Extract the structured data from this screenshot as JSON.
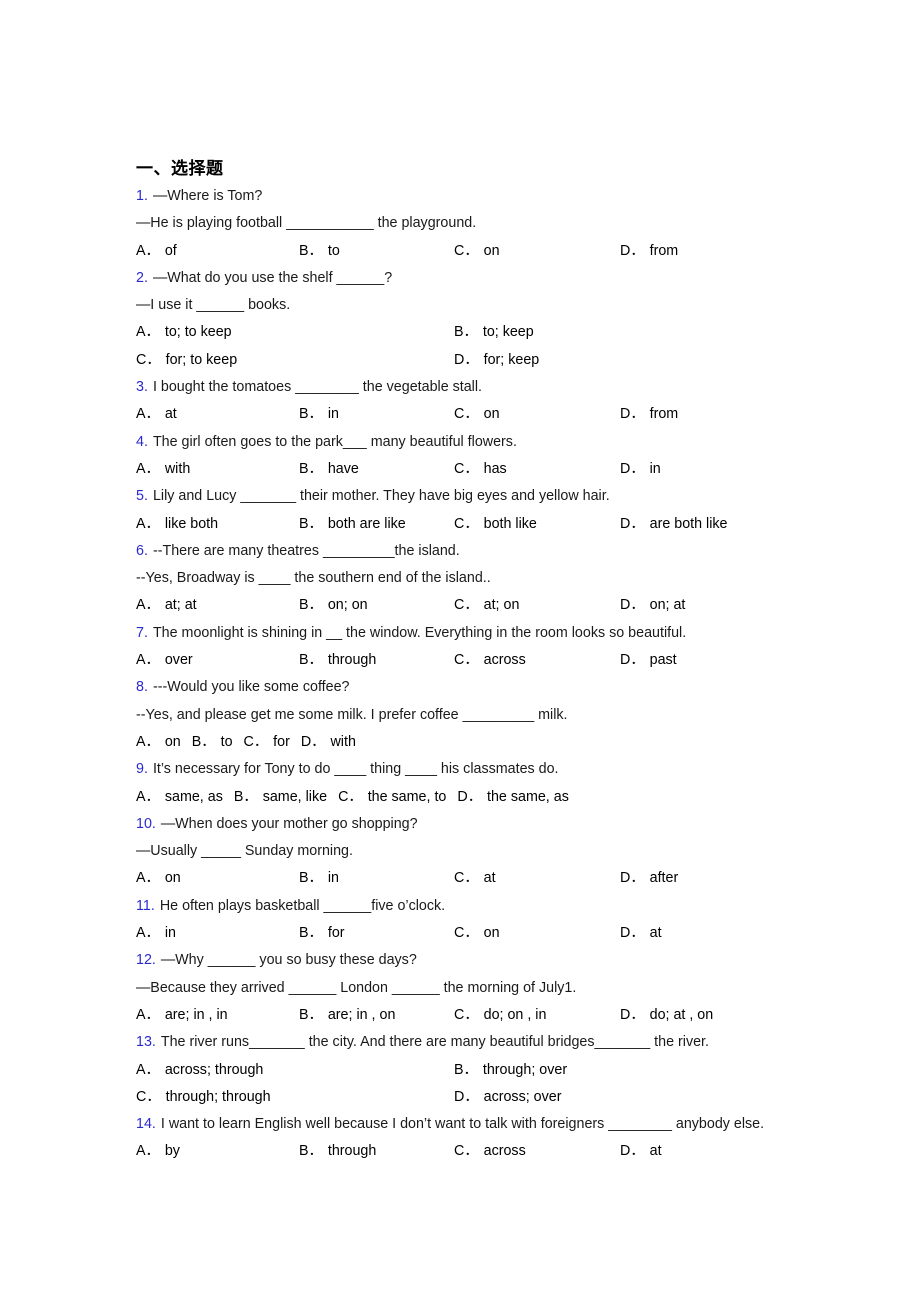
{
  "section": {
    "title": "一、选择题"
  },
  "accent_color": "#2a2ad0",
  "questions": [
    {
      "num": "1.",
      "lines": [
        "—Where is Tom?",
        "—He is playing football ___________ the playground."
      ],
      "layout": "cols4",
      "options": [
        {
          "letter": "A．",
          "text": "of"
        },
        {
          "letter": "B．",
          "text": "to"
        },
        {
          "letter": "C．",
          "text": "on"
        },
        {
          "letter": "D．",
          "text": "from"
        }
      ]
    },
    {
      "num": "2.",
      "lines": [
        "—What do you use the shelf ______?",
        "—I use it ______ books."
      ],
      "layout": "cols2x2",
      "options": [
        {
          "letter": "A．",
          "text": "to; to keep"
        },
        {
          "letter": "B．",
          "text": "to; keep"
        },
        {
          "letter": "C．",
          "text": "for; to keep"
        },
        {
          "letter": "D．",
          "text": "for; keep"
        }
      ]
    },
    {
      "num": "3.",
      "lines": [
        "I bought the tomatoes ________ the vegetable stall."
      ],
      "layout": "cols4",
      "options": [
        {
          "letter": "A．",
          "text": "at"
        },
        {
          "letter": "B．",
          "text": "in"
        },
        {
          "letter": "C．",
          "text": "on"
        },
        {
          "letter": "D．",
          "text": "from"
        }
      ]
    },
    {
      "num": "4.",
      "lines": [
        "The girl often goes to the park___ many beautiful flowers."
      ],
      "layout": "cols4",
      "options": [
        {
          "letter": "A．",
          "text": "with"
        },
        {
          "letter": "B．",
          "text": "have"
        },
        {
          "letter": "C．",
          "text": "has"
        },
        {
          "letter": "D．",
          "text": "in"
        }
      ]
    },
    {
      "num": "5.",
      "lines": [
        "Lily and Lucy _______ their mother. They have big eyes and yellow hair."
      ],
      "layout": "cols4",
      "options": [
        {
          "letter": "A．",
          "text": "like both"
        },
        {
          "letter": "B．",
          "text": "both are like"
        },
        {
          "letter": "C．",
          "text": "both like"
        },
        {
          "letter": "D．",
          "text": "are both like"
        }
      ]
    },
    {
      "num": "6.",
      "lines": [
        "--There are many theatres _________the island.",
        "--Yes, Broadway is ____ the southern end of the island.."
      ],
      "layout": "cols4",
      "options": [
        {
          "letter": "A．",
          "text": "at; at"
        },
        {
          "letter": "B．",
          "text": "on; on"
        },
        {
          "letter": "C．",
          "text": "at; on"
        },
        {
          "letter": "D．",
          "text": "on; at"
        }
      ]
    },
    {
      "num": "7.",
      "lines": [
        "The moonlight is shining in __ the window. Everything in the room looks so beautiful."
      ],
      "layout": "cols4",
      "options": [
        {
          "letter": "A．",
          "text": "over"
        },
        {
          "letter": "B．",
          "text": "through"
        },
        {
          "letter": "C．",
          "text": "across"
        },
        {
          "letter": "D．",
          "text": "past"
        }
      ]
    },
    {
      "num": "8.",
      "lines": [
        "---Would you like some coffee?",
        "--Yes, and please get me some milk. I prefer coffee _________ milk."
      ],
      "layout": "inline",
      "options": [
        {
          "letter": "A．",
          "text": "on"
        },
        {
          "letter": "B．",
          "text": "to"
        },
        {
          "letter": "C．",
          "text": "for"
        },
        {
          "letter": "D．",
          "text": "with"
        }
      ]
    },
    {
      "num": "9.",
      "lines": [
        "It’s necessary for Tony to do ____ thing ____ his classmates do."
      ],
      "layout": "inline",
      "options": [
        {
          "letter": "A．",
          "text": "same, as"
        },
        {
          "letter": "B．",
          "text": "same, like"
        },
        {
          "letter": "C．",
          "text": "the same, to"
        },
        {
          "letter": "D．",
          "text": "the same, as"
        }
      ]
    },
    {
      "num": "10.",
      "lines": [
        "—When does your mother go shopping?",
        "—Usually _____ Sunday morning."
      ],
      "layout": "cols4",
      "options": [
        {
          "letter": "A．",
          "text": "on"
        },
        {
          "letter": "B．",
          "text": "in"
        },
        {
          "letter": "C．",
          "text": "at"
        },
        {
          "letter": "D．",
          "text": "after"
        }
      ]
    },
    {
      "num": "11.",
      "lines": [
        "He often plays basketball ______five o’clock."
      ],
      "layout": "cols4",
      "options": [
        {
          "letter": "A．",
          "text": "in"
        },
        {
          "letter": "B．",
          "text": "for"
        },
        {
          "letter": "C．",
          "text": "on"
        },
        {
          "letter": "D．",
          "text": "at"
        }
      ]
    },
    {
      "num": "12.",
      "lines": [
        "—Why ______ you so busy these days?",
        "—Because they arrived ______ London ______ the morning of July1."
      ],
      "layout": "cols4",
      "options": [
        {
          "letter": "A．",
          "text": "are; in , in"
        },
        {
          "letter": "B．",
          "text": "are; in , on"
        },
        {
          "letter": "C．",
          "text": "do; on , in"
        },
        {
          "letter": "D．",
          "text": "do; at , on"
        }
      ]
    },
    {
      "num": "13.",
      "lines": [
        "The river runs_______ the city. And there are many beautiful bridges_______ the river."
      ],
      "layout": "cols2x2",
      "options": [
        {
          "letter": "A．",
          "text": "across; through"
        },
        {
          "letter": "B．",
          "text": "through; over"
        },
        {
          "letter": "C．",
          "text": "through; through"
        },
        {
          "letter": "D．",
          "text": "across; over"
        }
      ]
    },
    {
      "num": "14.",
      "lines": [
        "I want to learn English well because I don’t want to talk with foreigners ________ anybody else."
      ],
      "layout": "cols4",
      "wrap": true,
      "options": [
        {
          "letter": "A．",
          "text": "by"
        },
        {
          "letter": "B．",
          "text": "through"
        },
        {
          "letter": "C．",
          "text": "across"
        },
        {
          "letter": "D．",
          "text": "at"
        }
      ]
    }
  ]
}
